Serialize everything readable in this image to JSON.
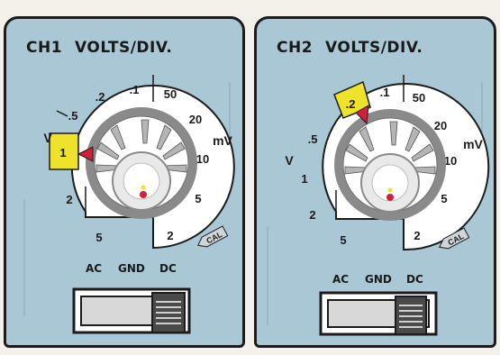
{
  "colors": {
    "panel": "#a9c7d4",
    "dial_face": "#ffffff",
    "knob_ring": "#8a8a8a",
    "highlight": "#efe22a",
    "pointer": "#d21f3c",
    "outline": "#1c1c1c"
  },
  "channels": [
    {
      "id": "ch1",
      "name": "CH1",
      "control_label": "VOLTS/DIV.",
      "unit_volts": "V",
      "unit_millivolts": "mV",
      "selected_setting": "1",
      "settings": [
        "2",
        "1",
        ".5",
        ".2",
        ".1",
        "50",
        "20",
        "10",
        "5",
        "2"
      ],
      "cal_label": "CAL",
      "coupling": {
        "options": [
          "AC",
          "GND",
          "DC"
        ],
        "selected": "DC"
      }
    },
    {
      "id": "ch2",
      "name": "CH2",
      "control_label": "VOLTS/DIV.",
      "unit_volts": "V",
      "unit_millivolts": "mV",
      "selected_setting": ".2",
      "settings": [
        "5",
        "2",
        "1",
        ".5",
        ".2",
        ".1",
        "50",
        "20",
        "10",
        "5",
        "2"
      ],
      "cal_label": "CAL",
      "coupling": {
        "options": [
          "AC",
          "GND",
          "DC"
        ],
        "selected": "DC"
      }
    }
  ]
}
